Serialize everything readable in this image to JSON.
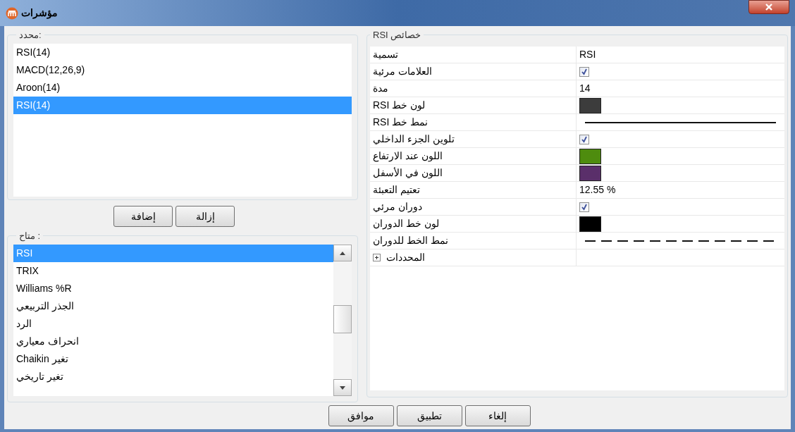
{
  "window": {
    "title": "مؤشرات"
  },
  "selected_group": {
    "label": "محدد:",
    "items": [
      {
        "label": "RSI(14)",
        "selected": false
      },
      {
        "label": "MACD(12,26,9)",
        "selected": false
      },
      {
        "label": "Aroon(14)",
        "selected": false
      },
      {
        "label": "RSI(14)",
        "selected": true
      }
    ]
  },
  "list_buttons": [
    "إزالة",
    "إضافة"
  ],
  "available_group": {
    "label": "متاح :",
    "items": [
      {
        "label": "RSI",
        "selected": true
      },
      {
        "label": "TRIX",
        "selected": false
      },
      {
        "label": "Williams %R",
        "selected": false
      },
      {
        "label": "الجذر التربيعي",
        "selected": false
      },
      {
        "label": "الرد",
        "selected": false
      },
      {
        "label": "انحراف معياري",
        "selected": false
      },
      {
        "label": "تغير Chaikin",
        "selected": false
      },
      {
        "label": "تغير تاريخي",
        "selected": false
      }
    ]
  },
  "properties": {
    "title": "خصائص RSI",
    "rows": [
      {
        "label": "تسمية",
        "kind": "text",
        "value": "RSI"
      },
      {
        "label": "العلامات مرئية",
        "kind": "checkbox",
        "checked": true
      },
      {
        "label": "مدة",
        "kind": "text",
        "value": "14"
      },
      {
        "label": "لون خط RSI",
        "kind": "color",
        "color": "#3c3c3c"
      },
      {
        "label": "نمط خط RSI",
        "kind": "solid-line"
      },
      {
        "label": "تلوين الجزء الداخلي",
        "kind": "checkbox",
        "checked": true
      },
      {
        "label": "اللون عند الارتفاع",
        "kind": "color",
        "color": "#4e8c0e"
      },
      {
        "label": "اللون في الأسفل",
        "kind": "color",
        "color": "#5a2f6a"
      },
      {
        "label": "تعتيم التعبئة",
        "kind": "text",
        "value": "12.55 %"
      },
      {
        "label": "دوران مرئي",
        "kind": "checkbox",
        "checked": true
      },
      {
        "label": "لون خط الدوران",
        "kind": "color",
        "color": "#000000"
      },
      {
        "label": "نمط الخط للدوران",
        "kind": "dashed-line"
      },
      {
        "label": "المحددات",
        "kind": "group",
        "expanded": false
      }
    ]
  },
  "buttons": [
    "إلغاء",
    "تطبيق",
    "موافق"
  ]
}
